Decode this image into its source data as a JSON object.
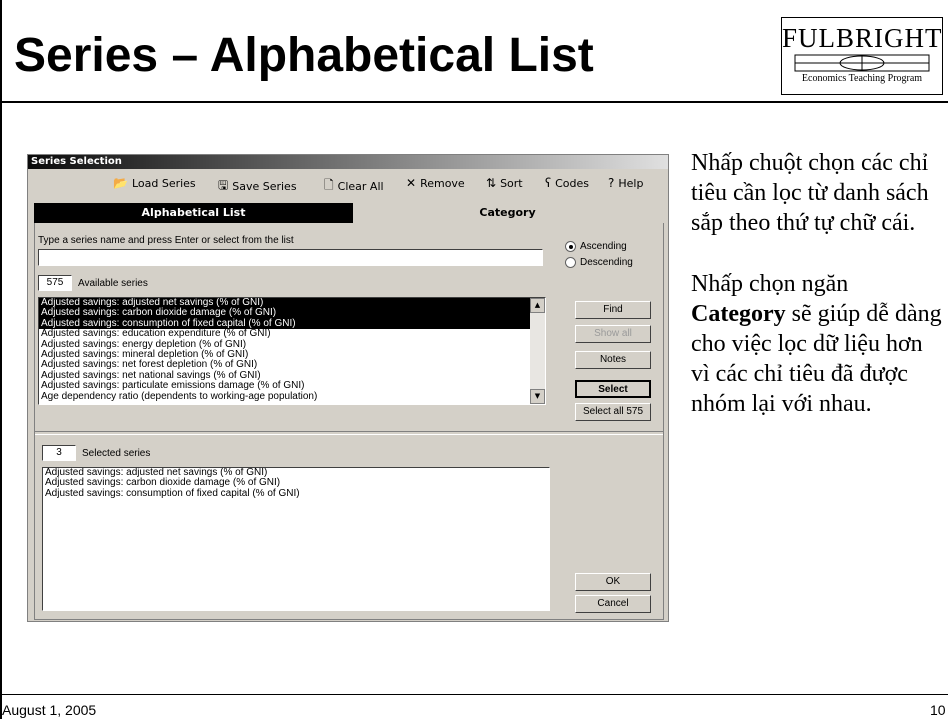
{
  "slide": {
    "title": "Series – Alphabetical List",
    "footer_date": "August 1, 2005",
    "page_number": "10"
  },
  "logo": {
    "main": "FULBRIGHT",
    "sub": "Economics Teaching Program"
  },
  "dialog": {
    "title": "Series Selection",
    "toolbar": [
      {
        "label": "Load Series",
        "icon": "load-folder-icon",
        "glyph": "📂"
      },
      {
        "label": "Save Series",
        "icon": "save-disk-icon",
        "glyph": "🖫"
      },
      {
        "label": "Clear All",
        "icon": "clear-page-icon",
        "glyph": "🗋"
      },
      {
        "label": "Remove",
        "icon": "remove-x-icon",
        "glyph": "✕"
      },
      {
        "label": "Sort",
        "icon": "sort-az-icon",
        "glyph": "⇅"
      },
      {
        "label": "Codes",
        "icon": "codes-icon",
        "glyph": "ʕ"
      },
      {
        "label": "Help",
        "icon": "help-icon",
        "glyph": "?"
      }
    ],
    "tabs": {
      "active": "Alphabetical List",
      "other": "Category"
    },
    "prompt": "Type a series name and press Enter or select from the list",
    "search_value": "",
    "sort": {
      "ascending": "Ascending",
      "descending": "Descending",
      "selected": "Ascending"
    },
    "available_count": "575",
    "available_label": "Available series",
    "available_items": [
      {
        "text": "Adjusted savings: adjusted net savings (% of GNI)",
        "selected": true
      },
      {
        "text": "Adjusted savings: carbon dioxide damage (% of GNI)",
        "selected": true
      },
      {
        "text": "Adjusted savings: consumption of fixed capital (% of GNI)",
        "selected": true
      },
      {
        "text": "Adjusted savings: education expenditure (% of GNI)",
        "selected": false
      },
      {
        "text": "Adjusted savings: energy depletion (% of GNI)",
        "selected": false
      },
      {
        "text": "Adjusted savings: mineral depletion (% of GNI)",
        "selected": false
      },
      {
        "text": "Adjusted savings: net forest depletion (% of GNI)",
        "selected": false
      },
      {
        "text": "Adjusted savings: net national savings (% of GNI)",
        "selected": false
      },
      {
        "text": "Adjusted savings: particulate emissions damage (% of GNI)",
        "selected": false
      },
      {
        "text": "Age dependency ratio (dependents to working-age population)",
        "selected": false
      }
    ],
    "buttons": {
      "find": "Find",
      "show_all": "Show all",
      "notes": "Notes",
      "select": "Select",
      "select_all": "Select all 575",
      "ok": "OK",
      "cancel": "Cancel"
    },
    "selected_count": "3",
    "selected_label": "Selected series",
    "selected_items": [
      "Adjusted savings: adjusted net savings (% of GNI)",
      "Adjusted savings: carbon dioxide damage (% of GNI)",
      "Adjusted savings: consumption of fixed capital (% of GNI)"
    ]
  },
  "instructions": {
    "p1": "Nhấp chuột chọn các chỉ tiêu cần lọc từ danh sách sắp theo thứ tự chữ cái.",
    "p2_bold": "Category",
    "p2_before": "Nhấp chọn ngăn ",
    "p2_after": " sẽ giúp dễ dàng cho việc lọc dữ liệu hơn vì các chỉ tiêu đã được nhóm lại với nhau."
  }
}
